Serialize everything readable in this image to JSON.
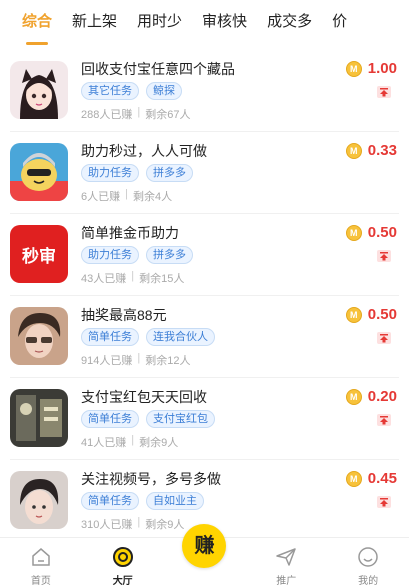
{
  "tabs": [
    "综合",
    "新上架",
    "用时少",
    "审核快",
    "成交多",
    "价"
  ],
  "tasks": [
    {
      "title": "回收支付宝任意四个藏品",
      "tags": [
        "其它任务",
        "鲸探"
      ],
      "earned": "288人已赚",
      "remaining": "剩余67人",
      "price": "1.00"
    },
    {
      "title": "助力秒过，人人可做",
      "tags": [
        "助力任务",
        "拼多多"
      ],
      "earned": "6人已赚",
      "remaining": "剩余4人",
      "price": "0.33"
    },
    {
      "title": "简单推金币助力",
      "tags": [
        "助力任务",
        "拼多多"
      ],
      "earned": "43人已赚",
      "remaining": "剩余15人",
      "price": "0.50",
      "avatar_text": "秒审"
    },
    {
      "title": "抽奖最高88元",
      "tags": [
        "简单任务",
        "连我合伙人"
      ],
      "earned": "914人已赚",
      "remaining": "剩余12人",
      "price": "0.50"
    },
    {
      "title": "支付宝红包天天回收",
      "tags": [
        "简单任务",
        "支付宝红包"
      ],
      "earned": "41人已赚",
      "remaining": "剩余9人",
      "price": "0.20"
    },
    {
      "title": "关注视频号，多号多做",
      "tags": [
        "简单任务",
        "自如业主"
      ],
      "earned": "310人已赚",
      "remaining": "剩余9人",
      "price": "0.45"
    }
  ],
  "coin_glyph": "M",
  "nav": {
    "home": "首页",
    "hall": "大厅",
    "earn": "赚",
    "promote": "推广",
    "mine": "我的"
  },
  "colors": {
    "accent": "#f0a22d",
    "price": "#e53935",
    "tag": "#3d7fd6",
    "earn": "#ffd400"
  }
}
